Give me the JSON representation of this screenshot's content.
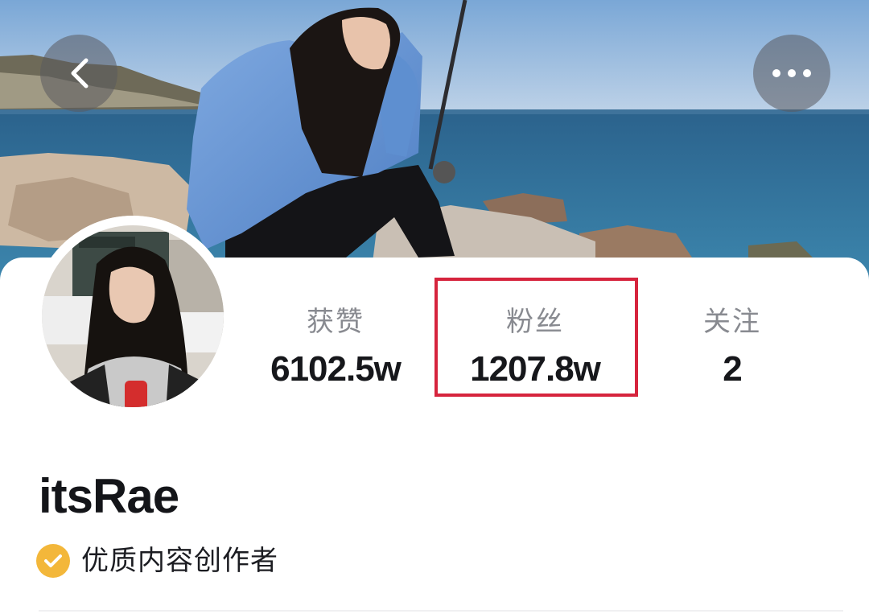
{
  "header": {
    "back_icon": "chevron-left-icon",
    "more_icon": "more-horizontal-icon"
  },
  "profile": {
    "username": "itsRae",
    "badge": {
      "icon": "check-circle-icon",
      "label": "优质内容创作者",
      "color": "#f3b73a"
    }
  },
  "stats": {
    "likes": {
      "label": "获赞",
      "value": "6102.5w"
    },
    "fans": {
      "label": "粉丝",
      "value": "1207.8w"
    },
    "following": {
      "label": "关注",
      "value": "2"
    }
  },
  "colors": {
    "highlight_border": "#d6243d",
    "text_primary": "#16171b",
    "text_secondary": "#888a90",
    "sky": "#8fb4db",
    "sea": "#2f6f99"
  }
}
